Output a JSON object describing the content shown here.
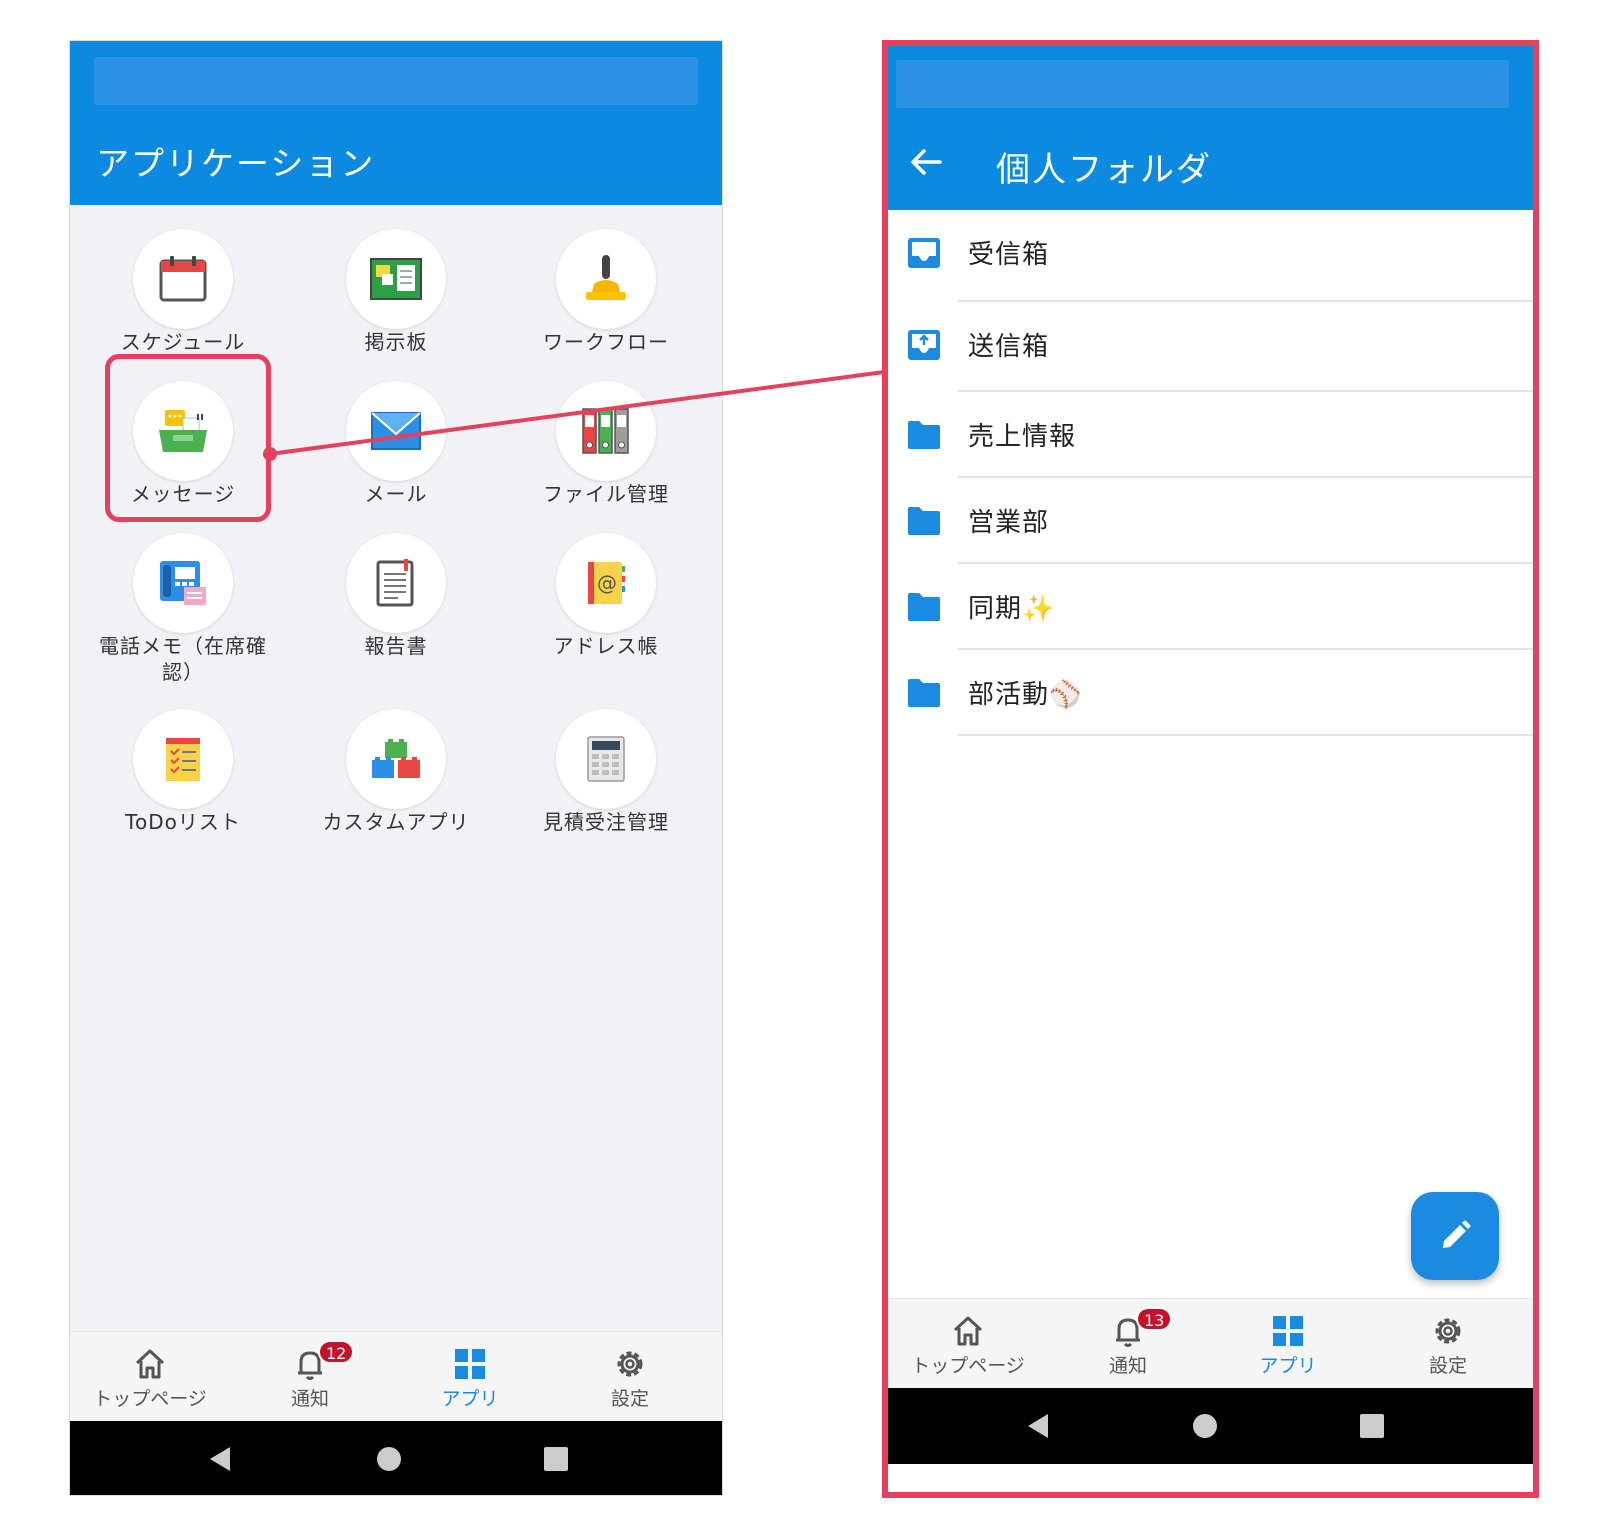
{
  "left_screen": {
    "title": "アプリケーション",
    "apps": [
      {
        "label": "スケジュール",
        "icon": "calendar-icon"
      },
      {
        "label": "掲示板",
        "icon": "bulletin-board-icon"
      },
      {
        "label": "ワークフロー",
        "icon": "stamp-icon"
      },
      {
        "label": "メッセージ",
        "icon": "message-tray-icon"
      },
      {
        "label": "メール",
        "icon": "envelope-icon"
      },
      {
        "label": "ファイル管理",
        "icon": "binders-icon"
      },
      {
        "label": "電話メモ（在席確",
        "label2": "認）",
        "icon": "phone-memo-icon"
      },
      {
        "label": "報告書",
        "icon": "report-icon"
      },
      {
        "label": "アドレス帳",
        "icon": "address-book-icon"
      },
      {
        "label": "ToDoリスト",
        "icon": "todo-list-icon"
      },
      {
        "label": "カスタムアプリ",
        "icon": "building-blocks-icon"
      },
      {
        "label": "見積受注管理",
        "icon": "calculator-icon"
      }
    ],
    "nav": {
      "home": "トップページ",
      "notify": "通知",
      "notify_badge": "12",
      "apps": "アプリ",
      "settings": "設定"
    }
  },
  "right_screen": {
    "title": "個人フォルダ",
    "folders": [
      {
        "label": "受信箱",
        "icon": "inbox-icon"
      },
      {
        "label": "送信箱",
        "icon": "outbox-icon"
      },
      {
        "label": "売上情報",
        "icon": "folder-icon"
      },
      {
        "label": "営業部",
        "icon": "folder-icon"
      },
      {
        "label": "同期✨",
        "icon": "folder-icon"
      },
      {
        "label": "部活動⚾",
        "icon": "folder-icon"
      }
    ],
    "nav": {
      "home": "トップページ",
      "notify": "通知",
      "notify_badge": "13",
      "apps": "アプリ",
      "settings": "設定"
    }
  },
  "colors": {
    "app_bar": "#0c8ae0",
    "accent": "#1a8be0",
    "highlight": "#e5405e",
    "badge": "#c4122c"
  }
}
